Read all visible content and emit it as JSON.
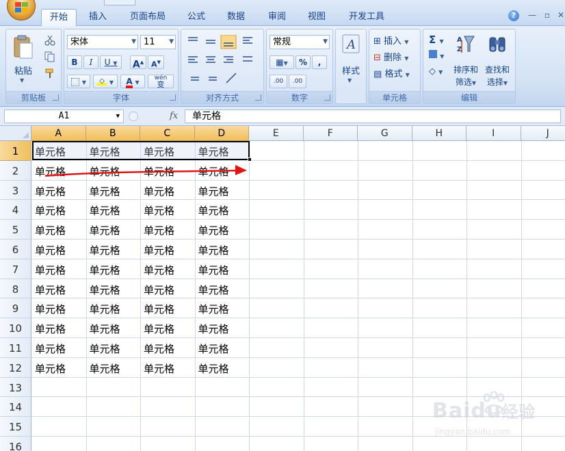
{
  "ribbon": {
    "tabs": [
      "开始",
      "插入",
      "页面布局",
      "公式",
      "数据",
      "审阅",
      "视图",
      "开发工具"
    ],
    "active_tab": "开始",
    "clipboard": {
      "paste_label": "粘贴",
      "group_label": "剪贴板"
    },
    "font": {
      "name": "宋体",
      "size": "11",
      "bold": "B",
      "italic": "I",
      "underline": "U",
      "grow": "A",
      "shrink": "A",
      "color_char": "A",
      "wen": "wén",
      "wen_char": "变",
      "group_label": "字体"
    },
    "alignment": {
      "group_label": "对齐方式"
    },
    "number": {
      "format": "常规",
      "percent": "%",
      "comma": ",",
      "inc_decimal": ".00",
      "dec_decimal": ".00",
      "group_label": "数字"
    },
    "styles": {
      "label": "样式"
    },
    "cells": {
      "insert": "插入",
      "delete": "删除",
      "format": "格式",
      "group_label": "单元格"
    },
    "editing": {
      "sigma": "Σ",
      "sort_line1": "排序和",
      "sort_line2": "筛选",
      "find_line1": "查找和",
      "find_line2": "选择",
      "group_label": "编辑"
    },
    "colors": {
      "accent": "#15428b",
      "selection_header": "#f1c05c",
      "arrow": "#e01616"
    }
  },
  "formula_bar": {
    "cell_ref": "A1",
    "fx": "fx",
    "content": "单元格"
  },
  "sheet": {
    "columns": [
      "A",
      "B",
      "C",
      "D",
      "E",
      "F",
      "G",
      "H",
      "I",
      "J"
    ],
    "selected_columns": [
      "A",
      "B",
      "C",
      "D"
    ],
    "rows": [
      "1",
      "2",
      "3",
      "4",
      "5",
      "6",
      "7",
      "8",
      "9",
      "10",
      "11",
      "12",
      "13",
      "14",
      "15",
      "16"
    ],
    "cell_text": "单元格",
    "filled_rows": 12,
    "filled_cols": 4
  },
  "watermark": {
    "brand": "Baidu",
    "brand_cn": "经验",
    "url": "jingyan.baidu.com"
  }
}
